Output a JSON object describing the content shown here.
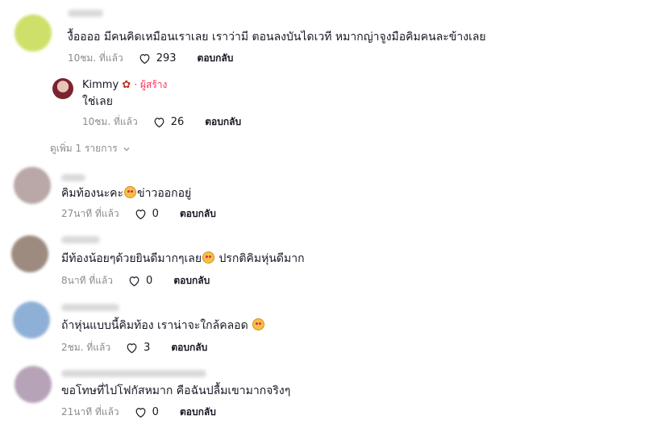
{
  "comments": [
    {
      "text": "งื้ออออ มีคนคิดเหมือนเราเลย เราว่ามี ตอนลงบันไดเวที หมากญ่าจูงมือคิมคนละข้างเลย",
      "time": "10ชม. ที่แล้ว",
      "likes": "293",
      "reply_label": "ตอบกลับ",
      "avatar_color": "#cfe06a"
    },
    {
      "text_before": "คิมท้องนะคะ",
      "text_after": "ข่าวออกอยู่",
      "time": "27นาที ที่แล้ว",
      "likes": "0",
      "reply_label": "ตอบกลับ",
      "avatar_color": "#b9a8a7"
    },
    {
      "text_before": "มีท้องน้อยๆด้วยยินดีมากๆเลย",
      "text_after": " ปรกติคิมหุ่นดีมาก",
      "time": "8นาที ที่แล้ว",
      "likes": "0",
      "reply_label": "ตอบกลับ",
      "avatar_color": "#9d8b80"
    },
    {
      "text_before": "ถ้าหุ่นแบบนี้คิมท้อง เราน่าจะใกล้คลอด ",
      "text_after": "",
      "time": "2ชม. ที่แล้ว",
      "likes": "3",
      "reply_label": "ตอบกลับ",
      "avatar_color": "#8fb0d6"
    },
    {
      "text": "ขอโทษที่ไปโฟกัสหมาก คือฉันปลื้มเขามากจริงๆ",
      "time": "21นาที ที่แล้ว",
      "likes": "0",
      "reply_label": "ตอบกลับ",
      "avatar_color": "#b7a3b8"
    }
  ],
  "creator_reply": {
    "name": "Kimmy",
    "badge": "· ผู้สร้าง",
    "text": "ใช่เลย",
    "time": "10ชม. ที่แล้ว",
    "likes": "26",
    "reply_label": "ตอบกลับ"
  },
  "view_more": "ดูเพิ่ม 1 รายการ",
  "icons": {
    "heart": "heart-outline-icon",
    "emoji": "smiling-face-with-heart-eyes-icon",
    "maple": "maple-leaf-icon",
    "chevron": "chevron-down-icon"
  }
}
